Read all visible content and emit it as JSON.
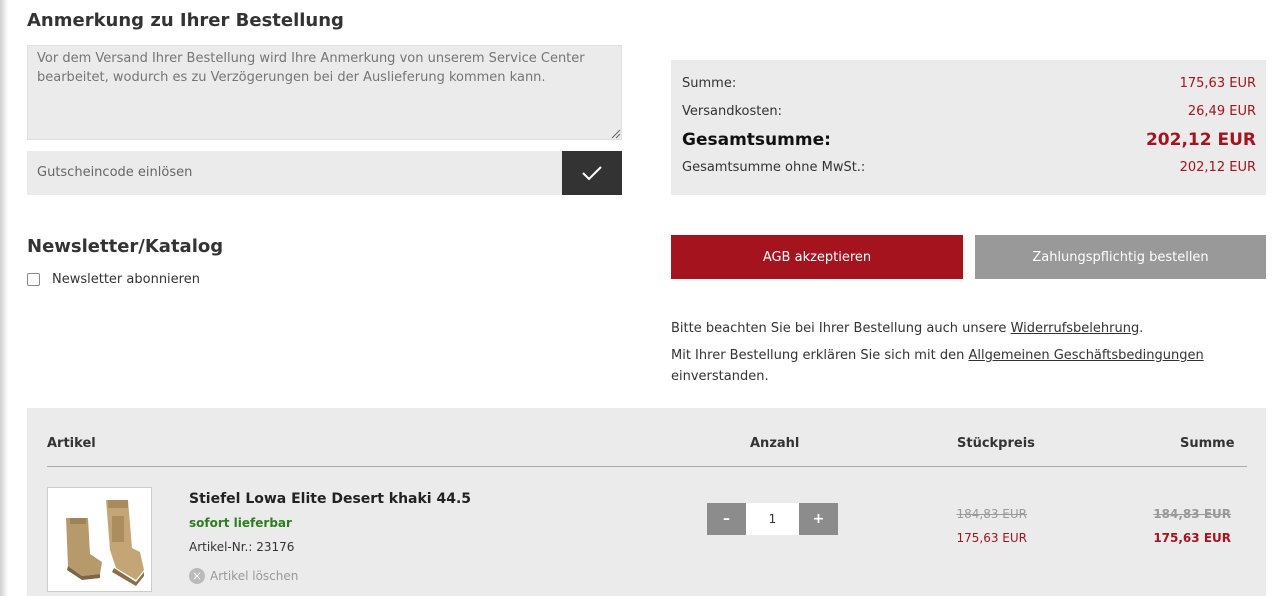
{
  "remark": {
    "title": "Anmerkung zu Ihrer Bestellung",
    "placeholder": "Vor dem Versand Ihrer Bestellung wird Ihre Anmerkung von unserem Service Center bearbeitet, wodurch es zu Verzögerungen bei der Auslieferung kommen kann."
  },
  "voucher": {
    "placeholder": "Gutscheincode einlösen",
    "submit_icon": "checkmark-icon"
  },
  "newsletter": {
    "title": "Newsletter/Katalog",
    "checkbox_label": "Newsletter abonnieren",
    "checked": false
  },
  "summary": {
    "rows": [
      {
        "label": "Summe:",
        "value": "175,63 EUR"
      },
      {
        "label": "Versandkosten:",
        "value": "26,49 EUR"
      },
      {
        "label": "Gesamtsumme:",
        "value": "202,12 EUR"
      },
      {
        "label": "Gesamtsumme ohne MwSt.:",
        "value": "202,12 EUR"
      }
    ]
  },
  "actions": {
    "agb_label": "AGB akzeptieren",
    "order_label": "Zahlungspflichtig bestellen"
  },
  "info": {
    "line1_prefix": "Bitte beachten Sie bei Ihrer Bestellung auch unsere ",
    "line1_link": "Widerrufsbelehrung",
    "line1_suffix": ".",
    "line2_prefix": "Mit Ihrer Bestellung erklären Sie sich mit den ",
    "line2_link": "Allgemeinen Geschäftsbedingungen",
    "line3": "einverstanden."
  },
  "cart": {
    "headers": {
      "article": "Artikel",
      "quantity": "Anzahl",
      "unit_price": "Stückpreis",
      "total": "Summe"
    },
    "items": [
      {
        "name": "Stiefel Lowa Elite Desert khaki 44.5",
        "availability": "sofort lieferbar",
        "sku": "Artikel-Nr.: 23176",
        "delete_label": "Artikel löschen",
        "quantity": "1",
        "unit_price_old": "184,83 EUR",
        "unit_price_new": "175,63 EUR",
        "total_old": "184,83 EUR",
        "total_new": "175,63 EUR"
      }
    ],
    "qty_minus": "–",
    "qty_plus": "+"
  },
  "colors": {
    "accent": "#a5141e",
    "panel": "#ebebeb",
    "available": "#2a7f1e"
  }
}
